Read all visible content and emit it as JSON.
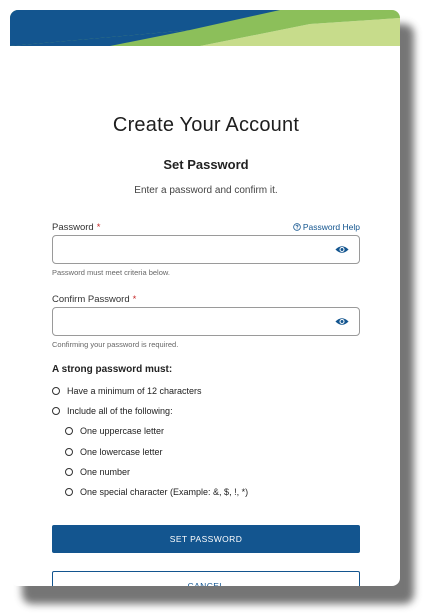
{
  "header": {
    "title": "Create Your Account",
    "subtitle": "Set Password",
    "instruction": "Enter a password and confirm it."
  },
  "password_field": {
    "label": "Password",
    "required_mark": "*",
    "value": "",
    "hint": "Password must meet criteria below.",
    "toggle_icon": "eye-icon"
  },
  "password_help": {
    "label": "Password Help",
    "icon": "help-circle-icon"
  },
  "confirm_field": {
    "label": "Confirm Password",
    "required_mark": "*",
    "value": "",
    "hint": "Confirming your password is required.",
    "toggle_icon": "eye-icon"
  },
  "criteria": {
    "title": "A strong password must:",
    "items": [
      "Have a minimum of 12 characters",
      "Include all of the following:"
    ],
    "sub_items": [
      "One uppercase letter",
      "One lowercase letter",
      "One number",
      "One special character (Example: &, $, !, *)"
    ]
  },
  "buttons": {
    "primary": "SET PASSWORD",
    "secondary": "CANCEL"
  },
  "colors": {
    "brand_blue": "#13558f",
    "banner_green": "#8cbf5a",
    "banner_light_green": "#c7dc8b",
    "required_red": "#c62828"
  }
}
